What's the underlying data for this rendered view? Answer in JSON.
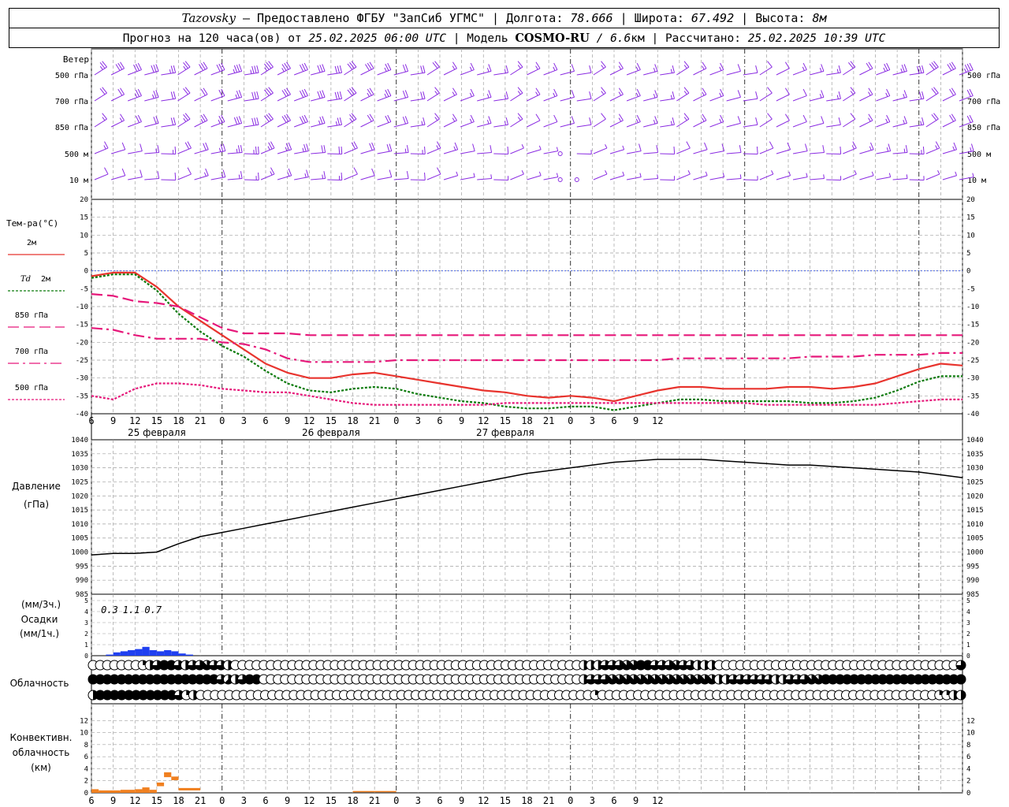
{
  "header": {
    "station": "Tazovsky",
    "provider": " — Предоставлено ФГБУ \"ЗапСиб УГМС\" | Долгота: ",
    "lon": "78.666",
    "lat_label": " | Широта: ",
    "lat": "67.492",
    "alt_label": " | Высота: ",
    "alt": "8м"
  },
  "subheader": {
    "forecast_label": "Прогноз на 120 часа(ов) от ",
    "issue_time": "25.02.2025 06:00 UTC",
    "model_label": " | Модель ",
    "model": "COSMO-RU",
    "resolution": " / 6.6",
    "resolution_unit": "км",
    "calc_label": " | Рассчитано: ",
    "calc_time": "25.02.2025 10:39 UTC"
  },
  "colors": {
    "wind": "#8a2be2",
    "t2m": "#e8342e",
    "td2m": "#0a7a0a",
    "t850": "#e6187a",
    "t700": "#e6187a",
    "t500": "#e6187a",
    "pressure": "#000000",
    "precip": "#1f3ff0",
    "convective": "#f08020",
    "zero_line": "#3050e0",
    "grid": "#a0a0a0"
  },
  "time_axis": {
    "hours_start": 6,
    "step_hours": 3,
    "hour_ticks": [
      "6",
      "9",
      "12",
      "15",
      "18",
      "21",
      "0",
      "3",
      "6",
      "9",
      "12",
      "15",
      "18",
      "21",
      "0",
      "3",
      "6",
      "9",
      "12",
      "15",
      "18",
      "21",
      "0",
      "3",
      "6",
      "9",
      "12"
    ],
    "dates": [
      "25 февраля",
      "26 февраля",
      "27 февраля"
    ]
  },
  "chart_data": [
    {
      "type": "wind-barbs",
      "panel": "wind",
      "title": "Ветер",
      "levels": [
        "500 гПа",
        "700 гПа",
        "850 гПа",
        "500 м",
        "10 м"
      ],
      "speeds_knots_at_x": {
        "500 гПа": [
          25,
          30,
          30,
          30,
          25,
          25,
          30,
          30,
          35,
          35,
          35,
          35,
          30,
          30,
          30,
          30,
          30,
          25,
          20,
          20,
          20,
          15,
          15,
          15,
          15,
          15,
          15,
          15,
          10,
          10,
          15,
          15,
          15,
          15,
          15,
          15,
          15,
          15,
          10,
          10,
          10,
          10,
          15,
          15,
          15,
          20,
          20,
          25,
          25,
          30,
          30,
          30,
          35
        ],
        "700 гПа": [
          20,
          20,
          25,
          25,
          20,
          20,
          20,
          20,
          25,
          30,
          30,
          30,
          30,
          30,
          30,
          30,
          25,
          25,
          20,
          20,
          15,
          15,
          15,
          15,
          15,
          15,
          15,
          15,
          10,
          10,
          15,
          15,
          15,
          15,
          15,
          15,
          15,
          15,
          10,
          10,
          10,
          10,
          10,
          15,
          15,
          15,
          15,
          15,
          15,
          20,
          20,
          20,
          20
        ],
        "850 гПа": [
          15,
          15,
          20,
          20,
          20,
          25,
          25,
          25,
          30,
          30,
          30,
          30,
          30,
          25,
          25,
          25,
          20,
          20,
          20,
          15,
          15,
          15,
          15,
          15,
          15,
          15,
          10,
          10,
          10,
          10,
          10,
          15,
          15,
          15,
          15,
          15,
          15,
          15,
          10,
          10,
          10,
          10,
          10,
          10,
          10,
          10,
          15,
          15,
          15,
          15,
          20,
          20,
          20
        ],
        "500 м": [
          15,
          10,
          10,
          15,
          15,
          20,
          20,
          25,
          25,
          25,
          25,
          25,
          25,
          20,
          20,
          20,
          20,
          20,
          15,
          15,
          15,
          15,
          10,
          10,
          10,
          5,
          5,
          5,
          0,
          5,
          5,
          5,
          10,
          10,
          10,
          10,
          10,
          10,
          10,
          10,
          10,
          10,
          10,
          10,
          10,
          15,
          15,
          15,
          15,
          15,
          15,
          15,
          15
        ],
        "10 м": [
          10,
          10,
          10,
          10,
          10,
          10,
          15,
          15,
          15,
          15,
          15,
          15,
          15,
          15,
          15,
          10,
          10,
          10,
          10,
          10,
          10,
          5,
          5,
          5,
          5,
          5,
          5,
          5,
          0,
          0,
          5,
          5,
          5,
          5,
          5,
          5,
          5,
          5,
          5,
          5,
          5,
          5,
          5,
          5,
          5,
          5,
          5,
          5,
          5,
          5,
          5,
          5,
          5
        ]
      }
    },
    {
      "type": "line",
      "panel": "temperature",
      "title": "Тем-ра(°С)",
      "ylim": [
        -40,
        20
      ],
      "yticks": [
        "20",
        "15",
        "10",
        "5",
        "0",
        "-5",
        "-10",
        "-15",
        "-20",
        "-25",
        "-30",
        "-35",
        "-40"
      ],
      "x_hours": [
        0,
        3,
        6,
        9,
        12,
        15,
        18,
        21,
        24,
        27,
        30,
        33,
        36,
        39,
        42,
        45,
        48,
        51,
        54,
        57,
        60,
        63,
        66,
        69,
        72,
        75,
        78,
        81,
        84,
        87,
        90,
        93,
        96,
        99,
        102,
        105,
        108,
        111,
        114,
        117,
        120
      ],
      "series": [
        {
          "name": "2м",
          "values": [
            -1.5,
            -0.5,
            -0.5,
            -4.5,
            -10,
            -14,
            -18,
            -22,
            -26,
            -28.5,
            -30,
            -30,
            -29,
            -28.5,
            -29.5,
            -30.5,
            -31.5,
            -32.5,
            -33.5,
            -34,
            -35,
            -35.5,
            -35,
            -35.5,
            -36.5,
            -35,
            -33.5,
            -32.5,
            -32.5,
            -33,
            -33,
            -33,
            -32.5,
            -32.5,
            -33,
            -32.5,
            -31.5,
            -29.5,
            -27.5,
            -26,
            -26.5
          ]
        },
        {
          "name": "Td 2м",
          "values": [
            -2,
            -1,
            -1,
            -5.5,
            -12,
            -17,
            -21,
            -24,
            -28,
            -31.5,
            -33.5,
            -34,
            -33,
            -32.5,
            -33,
            -34.5,
            -35.5,
            -36.5,
            -37,
            -38,
            -38.5,
            -38.5,
            -38,
            -38,
            -39,
            -38,
            -37,
            -36,
            -36,
            -36.5,
            -36.5,
            -36.5,
            -36.5,
            -37,
            -37,
            -36.5,
            -35.5,
            -33.5,
            -31,
            -29.5,
            -29.5
          ]
        },
        {
          "name": "850 гПа",
          "values": [
            -6.5,
            -7,
            -8.5,
            -9,
            -10,
            -13,
            -16,
            -17.5,
            -17.5,
            -17.5,
            -18,
            -18,
            -18,
            -18,
            -18,
            -18,
            -18,
            -18,
            -18,
            -18,
            -18,
            -18,
            -18,
            -18,
            -18,
            -18,
            -18,
            -18,
            -18,
            -18,
            -18,
            -18,
            -18,
            -18,
            -18,
            -18,
            -18,
            -18,
            -18,
            -18,
            -18
          ]
        },
        {
          "name": "700 гПа",
          "values": [
            -16,
            -16.5,
            -18,
            -19,
            -19,
            -19,
            -20,
            -20.5,
            -22,
            -24.5,
            -25.5,
            -25.5,
            -25.5,
            -25.5,
            -25,
            -25,
            -25,
            -25,
            -25,
            -25,
            -25,
            -25,
            -25,
            -25,
            -25,
            -25,
            -25,
            -24.5,
            -24.5,
            -24.5,
            -24.5,
            -24.5,
            -24.5,
            -24,
            -24,
            -24,
            -23.5,
            -23.5,
            -23.5,
            -23,
            -23
          ]
        },
        {
          "name": "500 гПа",
          "values": [
            -35,
            -36,
            -33,
            -31.5,
            -31.5,
            -32,
            -33,
            -33.5,
            -34,
            -34,
            -35,
            -36,
            -37,
            -37.5,
            -37.5,
            -37.5,
            -37.5,
            -37.5,
            -37.5,
            -37,
            -37,
            -37,
            -37,
            -37,
            -37,
            -37,
            -37,
            -37,
            -37,
            -37,
            -37,
            -37.5,
            -37.5,
            -37.5,
            -37.5,
            -37.5,
            -37.5,
            -37,
            -36.5,
            -36,
            -36
          ]
        }
      ],
      "legend": [
        "2м",
        "Td 2м",
        "850 гПа",
        "700 гПа",
        "500 гПа"
      ]
    },
    {
      "type": "line",
      "panel": "pressure",
      "title": "Давление",
      "unit": "(гПа)",
      "ylim": [
        985,
        1040
      ],
      "yticks": [
        "1040",
        "1035",
        "1030",
        "1025",
        "1020",
        "1015",
        "1010",
        "1005",
        "1000",
        "995",
        "990",
        "985"
      ],
      "x_hours": [
        0,
        3,
        6,
        9,
        12,
        15,
        18,
        21,
        24,
        27,
        30,
        33,
        36,
        39,
        42,
        45,
        48,
        51,
        54,
        57,
        60,
        63,
        66,
        69,
        72,
        75,
        78,
        81,
        84,
        87,
        90,
        93,
        96,
        99,
        102,
        105,
        108,
        111,
        114,
        117,
        120
      ],
      "series": [
        {
          "name": "Давление",
          "values": [
            999,
            999.5,
            999.5,
            1000,
            1003,
            1005.5,
            1007,
            1008.5,
            1010,
            1011.5,
            1013,
            1014.5,
            1016,
            1017.5,
            1019,
            1020.5,
            1022,
            1023.5,
            1025,
            1026.5,
            1028,
            1029,
            1030,
            1031,
            1032,
            1032.5,
            1033,
            1033,
            1033,
            1032.5,
            1032,
            1031.5,
            1031,
            1031,
            1030.5,
            1030,
            1029.5,
            1029,
            1028.5,
            1027.5,
            1026.5
          ]
        }
      ]
    },
    {
      "type": "bar",
      "panel": "precipitation",
      "title": "Осадки",
      "unit_top": "(мм/3ч.)",
      "unit_bottom": "(мм/1ч.)",
      "ylim": [
        0,
        5
      ],
      "yticks": [
        "5",
        "4",
        "3",
        "2",
        "1",
        "0"
      ],
      "totals_3h": [
        "0.3",
        "1.1",
        "0.7"
      ],
      "x_hours": [
        2,
        3,
        4,
        5,
        6,
        7,
        8,
        9,
        10,
        11,
        12,
        13
      ],
      "values": [
        0.1,
        0.3,
        0.4,
        0.5,
        0.6,
        0.8,
        0.5,
        0.4,
        0.5,
        0.4,
        0.2,
        0.1
      ]
    },
    {
      "type": "cloud-cover-rows",
      "panel": "cloudiness",
      "title": "Облачность",
      "rows": 3,
      "note": "octas per step, rows top to bottom: upper, middle, low",
      "values_upper": [
        0,
        0,
        0,
        0,
        0,
        0,
        0,
        2,
        4,
        6,
        8,
        8,
        6,
        4,
        6,
        6,
        7,
        6,
        6,
        4,
        0,
        0,
        0,
        0,
        0,
        0,
        0,
        0,
        0,
        0,
        0,
        0,
        0,
        0,
        0,
        0,
        0,
        0,
        0,
        0,
        0,
        0,
        0,
        0,
        0,
        0,
        0,
        0,
        0,
        0,
        0,
        0,
        0,
        0,
        0,
        0,
        0,
        0,
        0,
        0,
        0,
        0,
        0,
        0,
        0,
        0,
        0,
        0,
        0,
        4,
        4,
        4,
        6,
        6,
        6,
        7,
        7,
        8,
        8,
        6,
        6,
        6,
        7,
        6,
        6,
        4,
        4,
        4,
        0,
        0,
        0,
        0,
        0,
        0,
        0,
        0,
        0,
        0,
        0,
        0,
        0,
        0,
        0,
        0,
        0,
        0,
        0,
        0,
        0,
        0,
        0,
        0,
        0,
        0,
        0,
        0,
        0,
        0,
        0,
        0,
        0,
        0,
        6
      ],
      "values_middle": [
        8,
        8,
        8,
        8,
        8,
        8,
        8,
        8,
        8,
        8,
        8,
        8,
        8,
        8,
        8,
        8,
        8,
        8,
        6,
        5,
        4,
        6,
        8,
        8,
        0,
        0,
        0,
        0,
        0,
        0,
        0,
        0,
        0,
        0,
        0,
        0,
        0,
        0,
        0,
        0,
        0,
        0,
        0,
        0,
        0,
        0,
        0,
        0,
        0,
        0,
        0,
        0,
        0,
        0,
        0,
        0,
        0,
        0,
        0,
        0,
        0,
        0,
        0,
        0,
        0,
        0,
        0,
        0,
        0,
        4,
        6,
        6,
        6,
        7,
        7,
        7,
        7,
        7,
        7,
        7,
        7,
        7,
        7,
        7,
        7,
        7,
        7,
        7,
        4,
        4,
        6,
        6,
        6,
        6,
        6,
        6,
        4,
        4,
        6,
        6,
        6,
        7,
        7,
        8,
        8,
        8,
        8,
        8,
        8,
        8,
        8,
        8,
        8,
        8,
        8,
        8,
        8,
        8,
        8,
        8,
        8,
        8,
        8
      ],
      "values_low": [
        4,
        8,
        8,
        8,
        8,
        8,
        8,
        8,
        8,
        8,
        8,
        8,
        6,
        2,
        4,
        0,
        0,
        0,
        0,
        0,
        0,
        0,
        0,
        0,
        0,
        0,
        0,
        0,
        0,
        0,
        0,
        0,
        0,
        0,
        0,
        0,
        0,
        0,
        0,
        0,
        0,
        0,
        0,
        0,
        0,
        0,
        0,
        0,
        0,
        0,
        0,
        0,
        0,
        0,
        0,
        0,
        0,
        0,
        0,
        0,
        0,
        0,
        0,
        0,
        0,
        0,
        0,
        0,
        0,
        0,
        2,
        0,
        0,
        0,
        0,
        0,
        0,
        0,
        0,
        0,
        0,
        0,
        0,
        0,
        0,
        0,
        0,
        0,
        0,
        0,
        0,
        0,
        0,
        0,
        0,
        0,
        0,
        0,
        0,
        0,
        0,
        0,
        0,
        0,
        0,
        0,
        0,
        0,
        0,
        0,
        0,
        0,
        0,
        0,
        0,
        0,
        0,
        0,
        2,
        2,
        4,
        4
      ]
    },
    {
      "type": "bar",
      "panel": "convective",
      "title": "Конвективн.",
      "title2": "облачность",
      "unit": "(км)",
      "ylim": [
        0,
        14
      ],
      "yticks": [
        "12",
        "10",
        "8",
        "6",
        "4",
        "2",
        "0"
      ],
      "segments": [
        {
          "x_from_h": 0,
          "x_to_h": 1,
          "base": 0,
          "top": 0.6
        },
        {
          "x_from_h": 1,
          "x_to_h": 4,
          "base": 0,
          "top": 0.4
        },
        {
          "x_from_h": 4,
          "x_to_h": 6,
          "base": 0,
          "top": 0.5
        },
        {
          "x_from_h": 6,
          "x_to_h": 7,
          "base": 0,
          "top": 0.6
        },
        {
          "x_from_h": 7,
          "x_to_h": 8,
          "base": 0,
          "top": 0.9
        },
        {
          "x_from_h": 8,
          "x_to_h": 9,
          "base": 0,
          "top": 0.5
        },
        {
          "x_from_h": 9,
          "x_to_h": 10,
          "base": 1.1,
          "top": 1.7
        },
        {
          "x_from_h": 10,
          "x_to_h": 11,
          "base": 2.6,
          "top": 3.4
        },
        {
          "x_from_h": 11,
          "x_to_h": 12,
          "base": 2.1,
          "top": 2.7
        },
        {
          "x_from_h": 12,
          "x_to_h": 15,
          "base": 0.4,
          "top": 0.8
        },
        {
          "x_from_h": 36,
          "x_to_h": 42,
          "base": 0.1,
          "top": 0.3
        }
      ]
    }
  ]
}
